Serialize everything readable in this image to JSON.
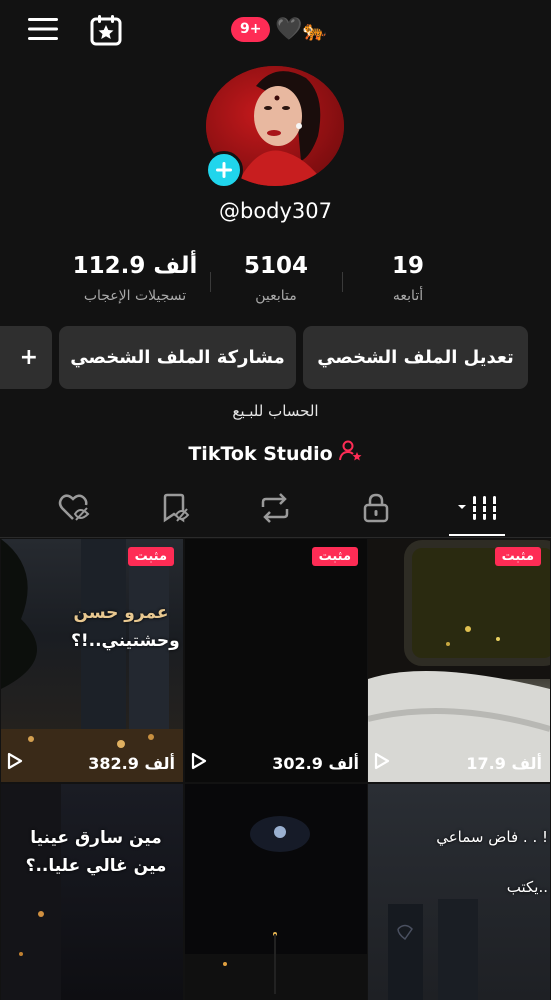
{
  "topbar": {
    "menu_icon": "hamburger-menu-icon",
    "calendar_icon": "calendar-star-icon",
    "notification_count": "9+",
    "emoji_heart": "🖤",
    "emoji_tiger": "🐅"
  },
  "profile": {
    "username": "@body307",
    "stats": {
      "likes": {
        "value": "112.9 ألف",
        "label": "تسجيلات الإعجاب"
      },
      "followers": {
        "value": "5104",
        "label": "متابعين"
      },
      "following": {
        "value": "19",
        "label": "أتابعه"
      }
    },
    "buttons": {
      "edit": "تعديل الملف الشخصي",
      "share": "مشاركة الملف الشخصي",
      "add_friend": "+"
    },
    "bio": "الحساب للبـيع",
    "studio": "TikTok Studio"
  },
  "tabs": [
    "videos-grid",
    "private-lock",
    "reposts",
    "favorites",
    "liked"
  ],
  "videos": [
    {
      "pinned": "مثبت",
      "views": "382.9 ألف",
      "text": [
        "عمرو حسن",
        "وحشتيني..!؟"
      ]
    },
    {
      "pinned": "مثبت",
      "views": "302.9 ألف",
      "text": []
    },
    {
      "pinned": "مثبت",
      "views": "17.9 ألف",
      "text": []
    },
    {
      "pinned": "",
      "views": "",
      "text": [
        "مين سارق عينيا",
        "مين غالي عليا..؟"
      ]
    },
    {
      "pinned": "",
      "views": "",
      "text": []
    },
    {
      "pinned": "",
      "views": "",
      "text": [
        "فاض سماعي . . !",
        "يكتب.."
      ]
    }
  ],
  "colors": {
    "background": "#121212",
    "accent_red": "#fe2c55",
    "accent_cyan": "#20d5ec",
    "button_bg": "#2f2f2f"
  }
}
